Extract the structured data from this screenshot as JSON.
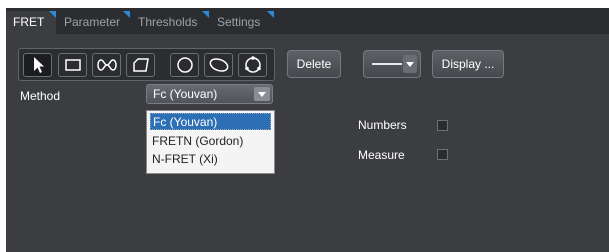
{
  "tabs": [
    {
      "label": "FRET",
      "active": true
    },
    {
      "label": "Parameter",
      "active": false
    },
    {
      "label": "Thresholds",
      "active": false
    },
    {
      "label": "Settings",
      "active": false
    }
  ],
  "tools": [
    {
      "name": "select-pointer-icon",
      "selected": true
    },
    {
      "name": "rectangle-tool-icon",
      "selected": false
    },
    {
      "name": "freehand-closed-icon",
      "selected": false
    },
    {
      "name": "polygon-tool-icon",
      "selected": false
    },
    {
      "name": "circle-tool-icon",
      "selected": false
    },
    {
      "name": "ellipse-tool-icon",
      "selected": false
    },
    {
      "name": "circle-points-tool-icon",
      "selected": false
    }
  ],
  "toolbar": {
    "delete_label": "Delete",
    "display_label": "Display ..."
  },
  "method": {
    "label": "Method",
    "selected": "Fc (Youvan)",
    "options": [
      "Fc (Youvan)",
      "FRETN (Gordon)",
      "N-FRET (Xi)"
    ]
  },
  "checks": {
    "numbers_label": "Numbers",
    "measure_label": "Measure"
  },
  "colors": {
    "panel_bg": "#3b3d40",
    "tab_accent": "#2d8ad8",
    "selection": "#2d6fb5"
  }
}
